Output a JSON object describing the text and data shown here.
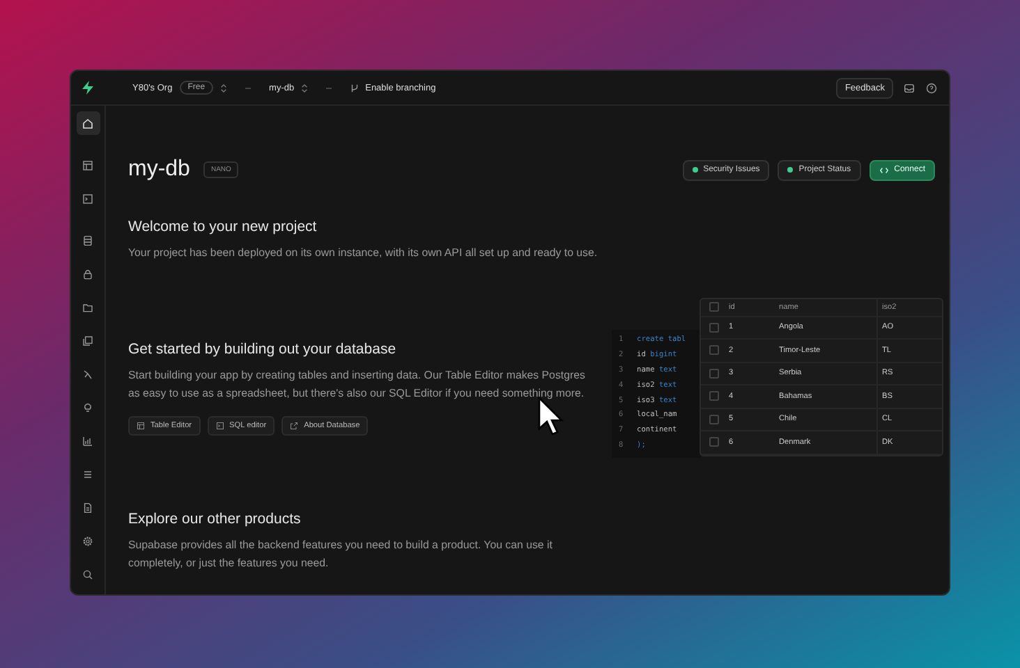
{
  "topbar": {
    "org": "Y80's Org",
    "plan": "Free",
    "project": "my-db",
    "branching": "Enable branching",
    "feedback": "Feedback"
  },
  "sidebar": {
    "items": [
      {
        "selected": true
      },
      {
        "selected": false
      },
      {
        "selected": false
      },
      {
        "selected": false
      },
      {
        "selected": false
      },
      {
        "selected": false
      },
      {
        "selected": false
      },
      {
        "selected": false
      },
      {
        "selected": false
      },
      {
        "selected": false
      },
      {
        "selected": false
      },
      {
        "selected": false
      },
      {
        "selected": false
      },
      {
        "selected": false
      }
    ]
  },
  "header": {
    "title": "my-db",
    "badge": "NANO",
    "actions": [
      {
        "label": "Security Issues",
        "kind": "status"
      },
      {
        "label": "Project Status",
        "kind": "status"
      },
      {
        "label": "Connect",
        "kind": "primary"
      }
    ]
  },
  "welcome": {
    "heading": "Welcome to your new project",
    "text": "Your project has been deployed on its own instance, with its own API all set up and ready to use."
  },
  "get_started": {
    "heading": "Get started by building out your database",
    "text": "Start building your app by creating tables and inserting data. Our Table Editor makes Postgres as easy to use as a spreadsheet, but there's also our SQL Editor if you need something more.",
    "buttons": [
      "Table Editor",
      "SQL editor",
      "About Database"
    ],
    "code": [
      {
        "number": "1",
        "tokens": [
          {
            "text": "create tabl",
            "kind": "keyword"
          }
        ]
      },
      {
        "number": "2",
        "tokens": [
          {
            "text": "id ",
            "kind": "plain"
          },
          {
            "text": "bigint",
            "kind": "keyword"
          }
        ]
      },
      {
        "number": "3",
        "tokens": [
          {
            "text": "name ",
            "kind": "plain"
          },
          {
            "text": "text",
            "kind": "keyword"
          }
        ]
      },
      {
        "number": "4",
        "tokens": [
          {
            "text": "iso2 ",
            "kind": "plain"
          },
          {
            "text": "text",
            "kind": "keyword"
          }
        ]
      },
      {
        "number": "5",
        "tokens": [
          {
            "text": "iso3 ",
            "kind": "plain"
          },
          {
            "text": "text",
            "kind": "keyword"
          }
        ]
      },
      {
        "number": "6",
        "tokens": [
          {
            "text": "local_nam",
            "kind": "plain"
          }
        ]
      },
      {
        "number": "7",
        "tokens": [
          {
            "text": "continent",
            "kind": "plain"
          }
        ]
      },
      {
        "number": "8",
        "tokens": [
          {
            "text": ");",
            "kind": "keyword"
          }
        ]
      }
    ],
    "table": {
      "all_checked": false,
      "columns": [
        "id",
        "name",
        "iso2"
      ],
      "rows": [
        {
          "checked": false,
          "cells": [
            "1",
            "Angola",
            "AO"
          ]
        },
        {
          "checked": false,
          "cells": [
            "2",
            "Timor-Leste",
            "TL"
          ]
        },
        {
          "checked": false,
          "cells": [
            "3",
            "Serbia",
            "RS"
          ]
        },
        {
          "checked": false,
          "cells": [
            "4",
            "Bahamas",
            "BS"
          ]
        },
        {
          "checked": false,
          "cells": [
            "5",
            "Chile",
            "CL"
          ]
        },
        {
          "checked": false,
          "cells": [
            "6",
            "Denmark",
            "DK"
          ]
        }
      ]
    }
  },
  "explore": {
    "heading": "Explore our other products",
    "text": "Supabase provides all the backend features you need to build a product. You can use it completely, or just the features you need."
  }
}
